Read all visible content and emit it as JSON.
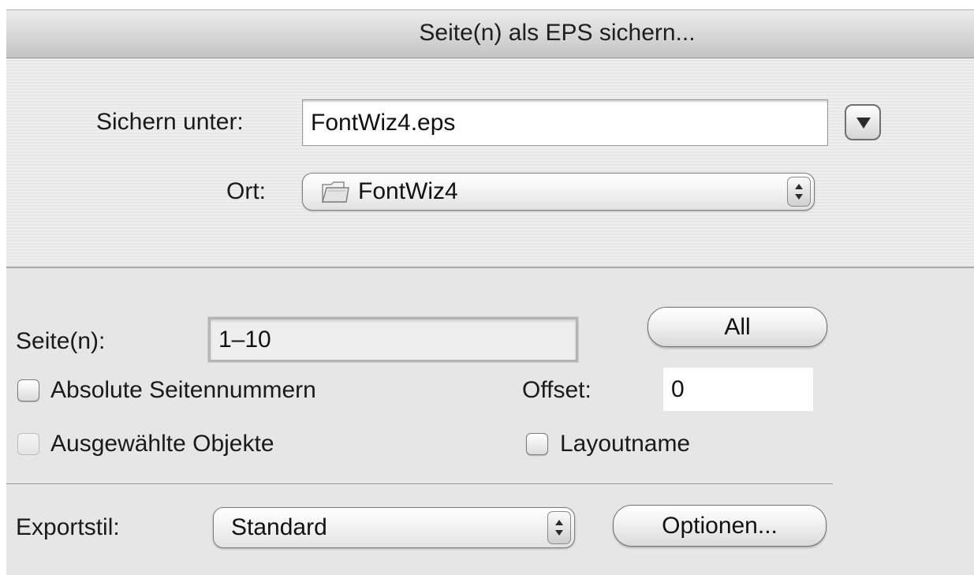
{
  "dialog": {
    "title": "Seite(n) als EPS sichern..."
  },
  "save_panel": {
    "save_as_label": "Sichern unter:",
    "filename_value": "FontWiz4.eps",
    "expand_button_icon": "disclosure-triangle-down-icon",
    "location_label": "Ort:",
    "location_value": "FontWiz4",
    "location_icon": "folder-icon"
  },
  "options": {
    "pages_label": "Seite(n):",
    "pages_value": "1–10",
    "all_button_label": "All",
    "absolute_pages_label": "Absolute Seitennummern",
    "absolute_pages_checked": false,
    "offset_label": "Offset:",
    "offset_value": "0",
    "selected_objects_label": "Ausgewählte Objekte",
    "selected_objects_enabled": false,
    "layoutname_label": "Layoutname",
    "layoutname_checked": false,
    "export_style_label": "Exportstil:",
    "export_style_value": "Standard",
    "options_button_label": "Optionen..."
  }
}
